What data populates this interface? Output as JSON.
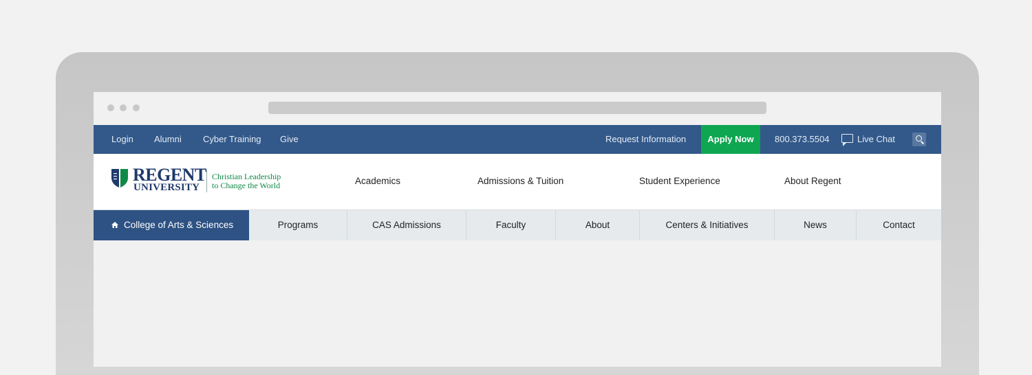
{
  "browser": {
    "window_dots": 3
  },
  "topbar": {
    "left_links": [
      "Login",
      "Alumni",
      "Cyber Training",
      "Give"
    ],
    "request_info": "Request Information",
    "apply_now": "Apply Now",
    "phone": "800.373.5504",
    "live_chat": "Live Chat",
    "icons": {
      "chat": "chat-bubble-icon",
      "search": "search-icon"
    },
    "colors": {
      "bar": "#33598a",
      "apply": "#0fa651"
    }
  },
  "logo": {
    "word1": "REGENT",
    "word2": "UNIVERSITY",
    "tagline_line1": "Christian Leadership",
    "tagline_line2": "to Change the World"
  },
  "main_nav": [
    "Academics",
    "Admissions & Tuition",
    "Student Experience",
    "About Regent"
  ],
  "sub_nav": {
    "home_label": "College of Arts & Sciences",
    "tabs": [
      "Programs",
      "CAS Admissions",
      "Faculty",
      "About",
      "Centers & Initiatives",
      "News",
      "Contact"
    ]
  }
}
